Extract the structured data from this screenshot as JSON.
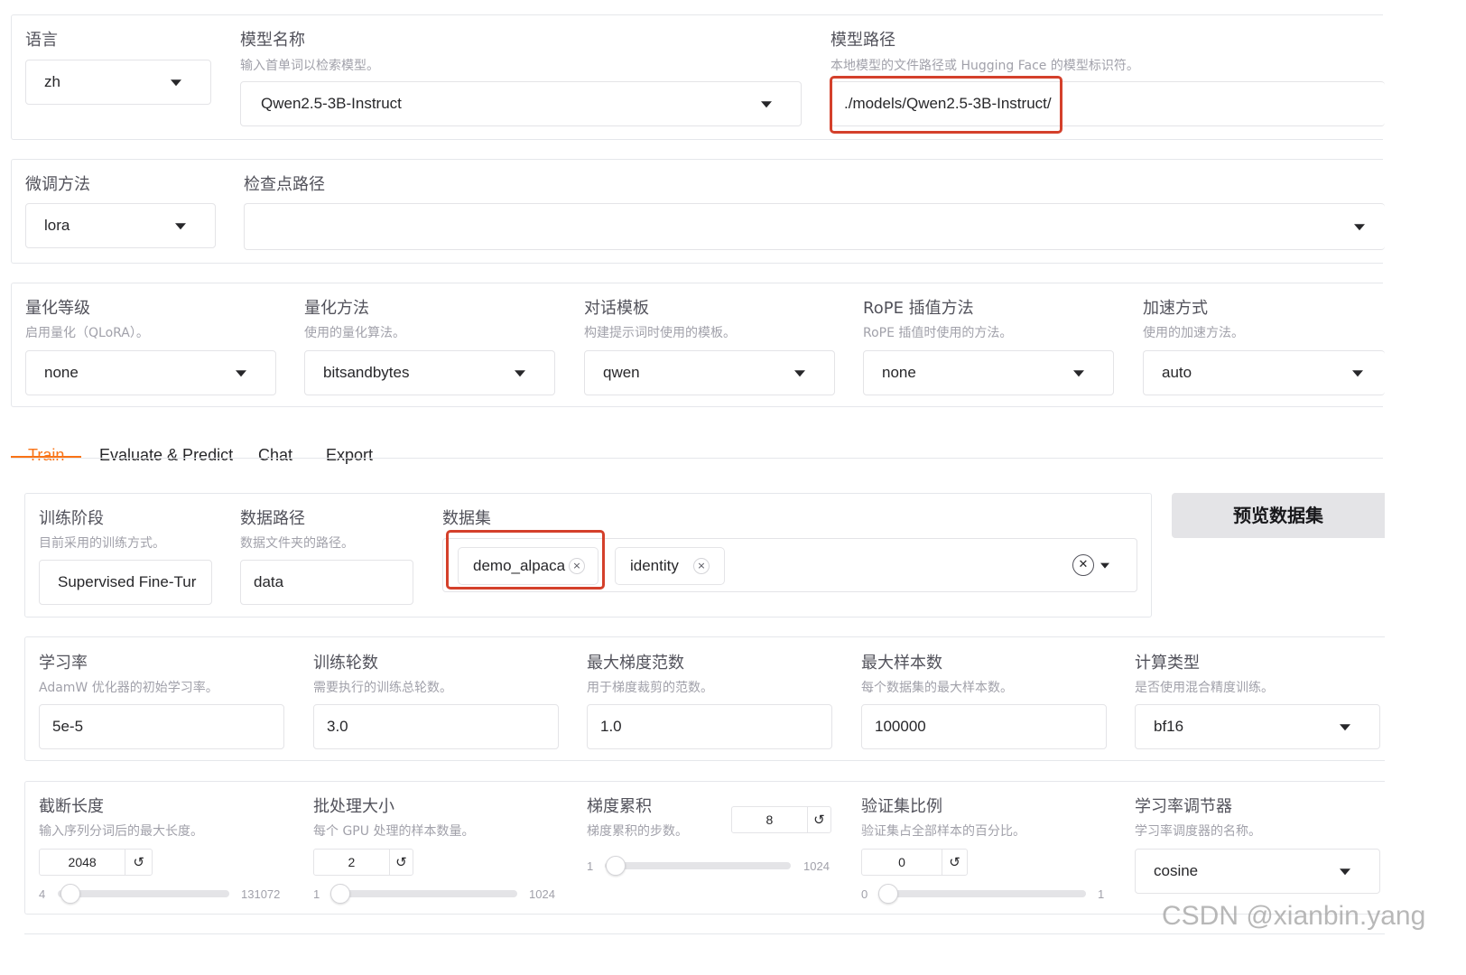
{
  "top": {
    "language": {
      "label": "语言",
      "value": "zh"
    },
    "model_name": {
      "label": "模型名称",
      "info": "输入首单词以检索模型。",
      "value": "Qwen2.5-3B-Instruct"
    },
    "model_path": {
      "label": "模型路径",
      "info": "本地模型的文件路径或 Hugging Face 的模型标识符。",
      "value": "./models/Qwen2.5-3B-Instruct/"
    }
  },
  "finetune": {
    "method": {
      "label": "微调方法",
      "value": "lora"
    },
    "checkpoint": {
      "label": "检查点路径",
      "value": ""
    }
  },
  "advanced": {
    "quant_bit": {
      "label": "量化等级",
      "info": "启用量化（QLoRA）。",
      "value": "none"
    },
    "quant_method": {
      "label": "量化方法",
      "info": "使用的量化算法。",
      "value": "bitsandbytes"
    },
    "template": {
      "label": "对话模板",
      "info": "构建提示词时使用的模板。",
      "value": "qwen"
    },
    "rope": {
      "label": "RoPE 插值方法",
      "info": "RoPE 插值时使用的方法。",
      "value": "none"
    },
    "booster": {
      "label": "加速方式",
      "info": "使用的加速方法。",
      "value": "auto"
    }
  },
  "tabs": [
    "Train",
    "Evaluate & Predict",
    "Chat",
    "Export"
  ],
  "train": {
    "stage": {
      "label": "训练阶段",
      "info": "目前采用的训练方式。",
      "value": "Supervised Fine-Tur"
    },
    "dataset_dir": {
      "label": "数据路径",
      "info": "数据文件夹的路径。",
      "value": "data"
    },
    "dataset": {
      "label": "数据集",
      "chips": [
        "demo_alpaca",
        "identity"
      ]
    },
    "preview_button": "预览数据集",
    "learning_rate": {
      "label": "学习率",
      "info": "AdamW 优化器的初始学习率。",
      "value": "5e-5"
    },
    "epochs": {
      "label": "训练轮数",
      "info": "需要执行的训练总轮数。",
      "value": "3.0"
    },
    "max_grad_norm": {
      "label": "最大梯度范数",
      "info": "用于梯度裁剪的范数。",
      "value": "1.0"
    },
    "max_samples": {
      "label": "最大样本数",
      "info": "每个数据集的最大样本数。",
      "value": "100000"
    },
    "compute_type": {
      "label": "计算类型",
      "info": "是否使用混合精度训练。",
      "value": "bf16"
    },
    "cutoff_len": {
      "label": "截断长度",
      "info": "输入序列分词后的最大长度。",
      "value": "2048",
      "min": "4",
      "max": "131072",
      "level": 0.0156
    },
    "batch_size": {
      "label": "批处理大小",
      "info": "每个 GPU 处理的样本数量。",
      "value": "2",
      "min": "1",
      "max": "1024",
      "level": 0.001
    },
    "grad_accum": {
      "label": "梯度累积",
      "info": "梯度累积的步数。",
      "value": "8",
      "min": "1",
      "max": "1024",
      "level": 0.0068
    },
    "val_size": {
      "label": "验证集比例",
      "info": "验证集占全部样本的百分比。",
      "value": "0",
      "min": "0",
      "max": "1",
      "level": 0
    },
    "lr_scheduler": {
      "label": "学习率调节器",
      "info": "学习率调度器的名称。",
      "value": "cosine"
    }
  },
  "icons": {
    "reset": "↺",
    "close": "×",
    "clear": "✕"
  },
  "watermark": "CSDN @xianbin.yang",
  "colors": {
    "accent": "#f97316",
    "highlight": "#d4402b"
  }
}
